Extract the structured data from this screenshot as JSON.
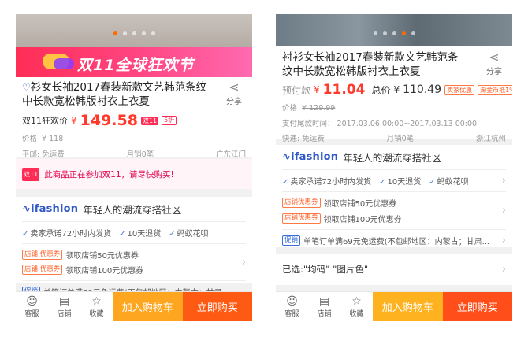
{
  "left": {
    "banner_text": "双11全球狂欢节",
    "title": "衫女长袖2017春装新款文艺韩范条纹中长款宽松韩版衬衣上衣夏",
    "share_label": "分享",
    "price_label": "双11狂欢价",
    "price_currency": "¥",
    "price_value": "149.58",
    "price_badge": "双11",
    "discount_badge": "5折",
    "orig_price_label": "价格",
    "orig_price": "¥ 118",
    "shipping": "平邮: 免运费",
    "monthly_sales": "月销0笔",
    "location": "广东江门",
    "notice_icon": "双11",
    "notice_text": "此商品正在参加双11，请尽快购买!",
    "brand_logo": "ifashion",
    "brand_slogan": "年轻人的潮流穿搭社区",
    "services": [
      "卖家承诺72小时内发货",
      "10天退货",
      "蚂蚁花呗"
    ],
    "coupons": [
      {
        "tag": "店铺 优惠券",
        "text": "领取店铺50元优惠券"
      },
      {
        "tag": "店铺 优惠券",
        "text": "领取店铺100元优惠券"
      }
    ],
    "promo_tag": "促销",
    "promo_text": "单笔订单满69元免运费(不包邮地区：内蒙古；甘肃..."
  },
  "right": {
    "title": "衬衫女长袖2017春装新款文艺韩范条纹中长款宽松韩版衬衣上衣夏",
    "share_label": "分享",
    "presale_label": "预付款",
    "presale_currency": "¥",
    "presale_value": "11.04",
    "total_label": "总价",
    "total_currency": "¥",
    "total_value": "110.49",
    "seller_tag": "卖家优惠",
    "coin_tag": "淘金币抵1%",
    "orig_price_label": "价格",
    "orig_price": "¥ 129.99",
    "balance_label": "支付尾款时间：",
    "balance_time": "2017.03.06 00:00~2017.03.13 00:00",
    "shipping": "快递: 免运费",
    "monthly_sales": "月销0笔",
    "location": "浙江杭州",
    "brand_logo": "ifashion",
    "brand_slogan": "年轻人的潮流穿搭社区",
    "services": [
      "卖家承诺72小时内发货",
      "10天退货",
      "蚂蚁花呗"
    ],
    "coupons": [
      {
        "tag": "店铺优惠券",
        "text": "领取店铺50元优惠券"
      },
      {
        "tag": "店铺优惠券",
        "text": "领取店铺100元优惠券"
      }
    ],
    "promo_tag": "促销",
    "promo_text": "单笔订单满69元免运费(不包邮地区：内蒙古；甘肃...",
    "selected_label": "已选:\"均码\" \"图片色\""
  },
  "bottom_bar": {
    "service": "客服",
    "shop": "店铺",
    "fav": "收藏",
    "add_cart": "加入购物车",
    "buy_now": "立即购买"
  },
  "colors": {
    "price_red": "#ff3a2c",
    "cart_orange": "#ffa620",
    "buy_orange": "#ff5a14",
    "brand_blue": "#2f58c8",
    "banner_pink": "#ff2d55"
  }
}
